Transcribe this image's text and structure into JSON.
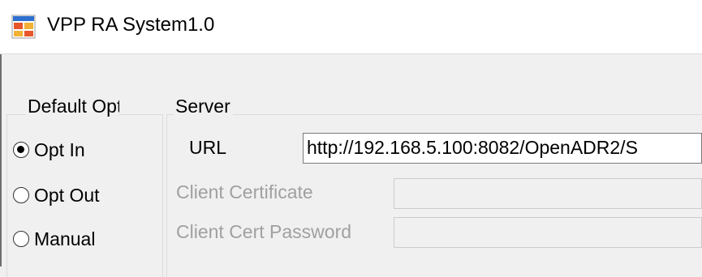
{
  "window": {
    "title": "VPP RA System1.0",
    "icon": "application-window-icon"
  },
  "default_opt": {
    "group_label": "Default Opt",
    "options": [
      {
        "label": "Opt In",
        "selected": true
      },
      {
        "label": "Opt Out",
        "selected": false
      },
      {
        "label": "Manual",
        "selected": false
      }
    ]
  },
  "server": {
    "group_label": "Server",
    "url_label": "URL",
    "url_value": "http://192.168.5.100:8082/OpenADR2/S",
    "client_certificate_label": "Client Certificate",
    "client_certificate_value": "",
    "client_cert_password_label": "Client Cert Password",
    "client_cert_password_value": ""
  },
  "colors": {
    "window_bg": "#f0f0f0",
    "titlebar_bg": "#ffffff",
    "disabled_text": "#a0a0a0"
  }
}
